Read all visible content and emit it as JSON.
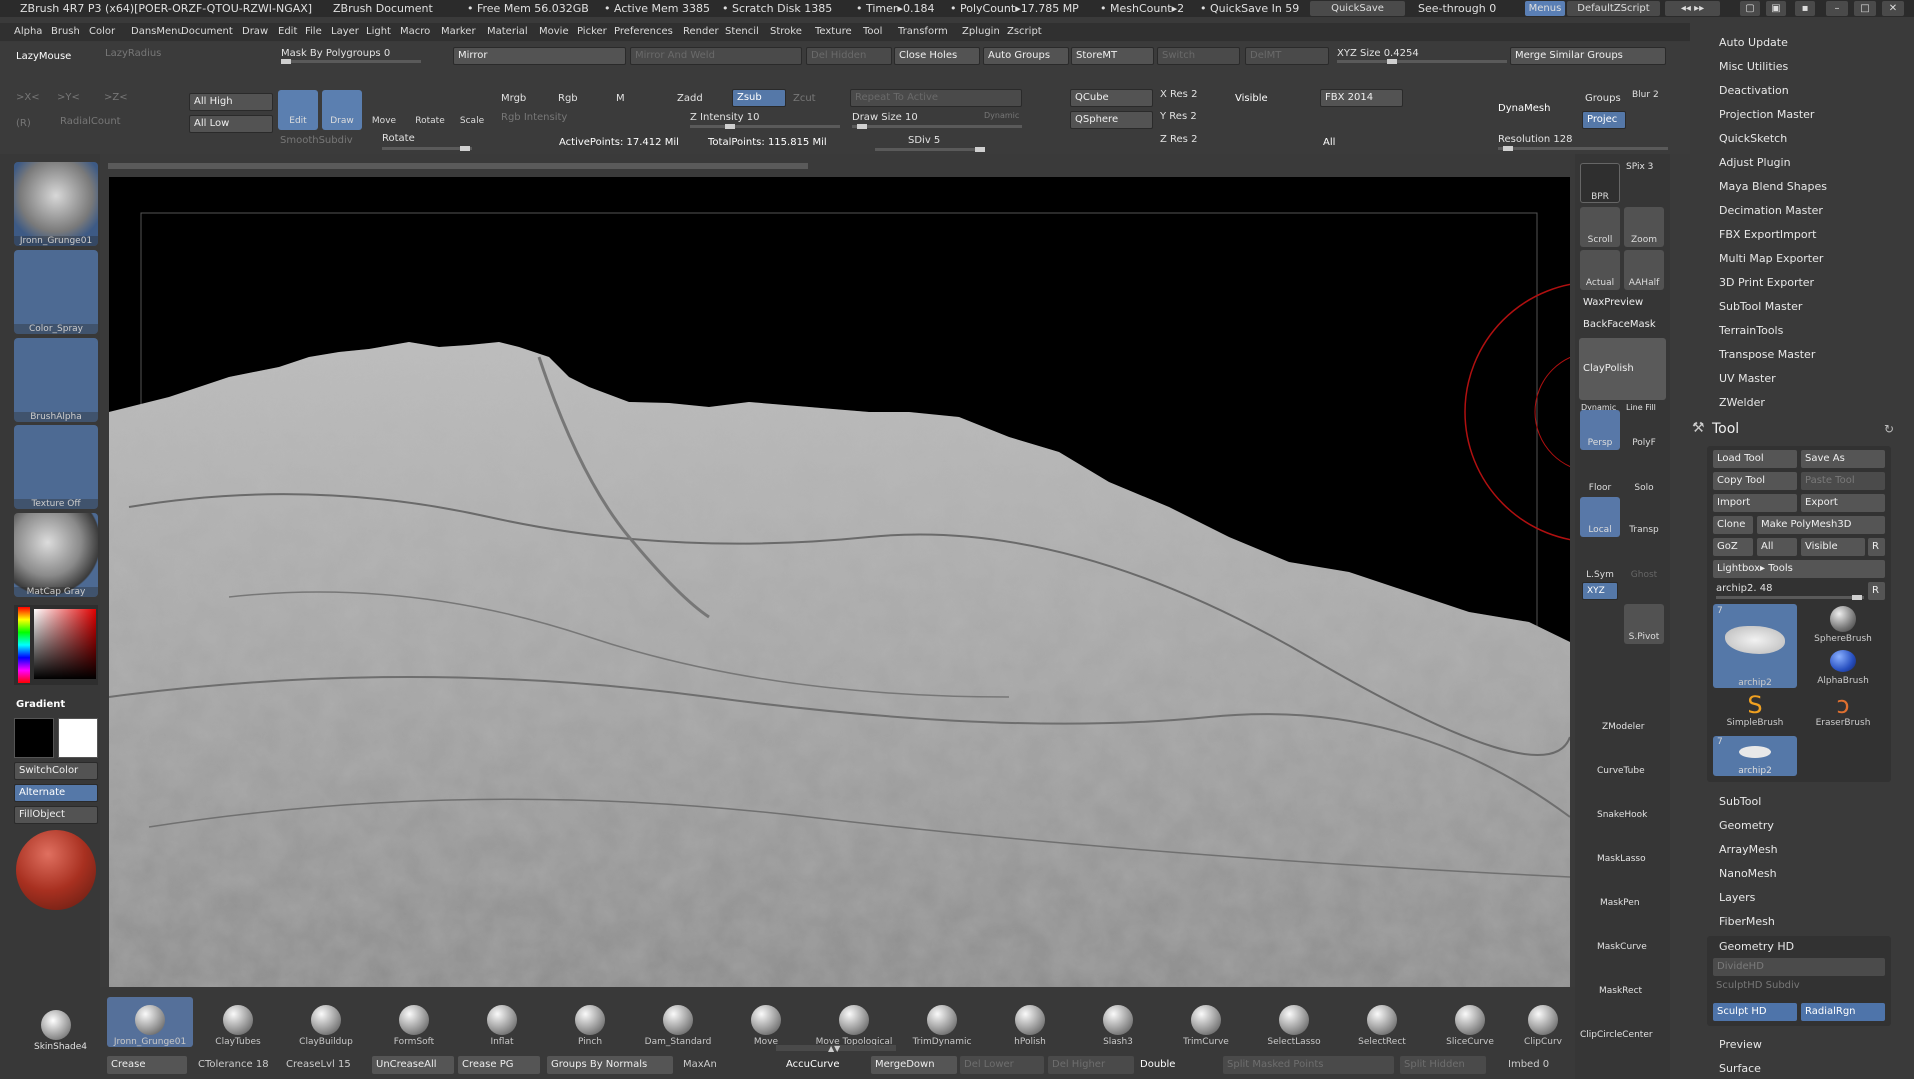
{
  "title": {
    "app": "ZBrush 4R7 P3 (x64)[POER-ORZF-QTOU-RZWI-NGAX]",
    "doc": "ZBrush Document",
    "freemem": "• Free Mem 56.032GB",
    "activemem": "• Active Mem 3385",
    "scratch": "• Scratch Disk 1385",
    "timer": "• Timer▸0.184",
    "poly": "• PolyCount▸17.785 MP",
    "meshcount": "• MeshCount▸2",
    "quicksave_in": "• QuickSave In 59",
    "quicksave": "QuickSave",
    "seethrough": "See-through 0",
    "menus": "Menus",
    "script": "DefaultZScript"
  },
  "menu": [
    "Alpha",
    "Brush",
    "Color",
    "DansMenu",
    "Document",
    "Draw",
    "Edit",
    "File",
    "Layer",
    "Light",
    "Macro",
    "Marker",
    "Material",
    "Movie",
    "Picker",
    "Preferences",
    "Render",
    "Stencil",
    "Stroke",
    "Texture",
    "Tool",
    "Transform",
    "Zplugin",
    "Zscript"
  ],
  "top": {
    "lazymouse": "LazyMouse",
    "lazyradius": "LazyRadius",
    "maskbypoly": "Mask By Polygroups 0",
    "mirror": "Mirror",
    "mirrorweld": "Mirror And Weld",
    "delhidden": "Del Hidden",
    "closeholes": "Close Holes",
    "autogroups": "Auto Groups",
    "storemt": "StoreMT",
    "switch": "Switch",
    "delmt": "DelMT",
    "xyzsize": "XYZ Size 0.4254",
    "mergesimilar": "Merge Similar Groups",
    "axisx": ">X<",
    "axisy": ">Y<",
    "axisz": ">Z<",
    "r": "(R)",
    "radialcount": "RadialCount",
    "allhigh": "All High",
    "alllow": "All Low",
    "smoothsubdiv": "SmoothSubdiv",
    "rotate": "Rotate",
    "edit": "Edit",
    "draw": "Draw",
    "move": "Move",
    "rotatet": "Rotate",
    "scale": "Scale",
    "mrgb": "Mrgb",
    "rgb": "Rgb",
    "m": "M",
    "zadd": "Zadd",
    "zsub": "Zsub",
    "zcut": "Zcut",
    "repeat": "Repeat To Active",
    "rgbint": "Rgb Intensity",
    "zint": "Z Intensity 10",
    "drawsize": "Draw Size 10",
    "dynamic": "Dynamic",
    "activepts": "ActivePoints: 17.412  Mil",
    "totalpts": "TotalPoints: 115.815  Mil",
    "sdiv": "SDiv 5",
    "qcube": "QCube",
    "qsphere": "QSphere",
    "xres": "X Res 2",
    "yres": "Y Res 2",
    "zres": "Z Res 2",
    "visible": "Visible",
    "all": "All",
    "fbx": "FBX 2014",
    "dynamesh": "DynaMesh",
    "groups": "Groups",
    "blur": "Blur 2",
    "projec": "Projec",
    "resolution": "Resolution 128"
  },
  "left": {
    "brush1": "Jronn_Grunge01",
    "brush2": "Color_Spray",
    "alpha": "BrushAlpha",
    "texture": "Texture Off",
    "matcap": "MatCap Gray",
    "gradient": "Gradient",
    "switchcolor": "SwitchColor",
    "alternate": "Alternate",
    "fillobject": "FillObject",
    "skinshade": "SkinShade4"
  },
  "strip": {
    "spix": "SPix 3",
    "bpr": "BPR",
    "scroll": "Scroll",
    "zoom": "Zoom",
    "actual": "Actual",
    "aahalf": "AAHalf",
    "waxpreview": "WaxPreview",
    "backfacemask": "BackFaceMask",
    "claypolish": "ClayPolish",
    "dynamic": "Dynamic",
    "persp": "Persp",
    "linefill": "Line Fill",
    "polyf": "PolyF",
    "floor": "Floor",
    "solo": "Solo",
    "local": "Local",
    "transp": "Transp",
    "lsym": "L.Sym",
    "ghost": "Ghost",
    "xyz": "XYZ",
    "spivot": "S.Pivot",
    "zmodeler": "ZModeler",
    "curvetube": "CurveTube",
    "snakehook": "SnakeHook",
    "masklasso": "MaskLasso",
    "maskpen": "MaskPen",
    "maskcurve": "MaskCurve",
    "maskrect": "MaskRect",
    "clipcircle": "ClipCircleCenter"
  },
  "tray": {
    "plugins": [
      "Auto Update",
      "Misc Utilities",
      "Deactivation",
      "Projection Master",
      "QuickSketch",
      "Adjust Plugin",
      "Maya Blend Shapes",
      "Decimation Master",
      "FBX ExportImport",
      "Multi Map Exporter",
      "3D Print Exporter",
      "SubTool Master",
      "TerrainTools",
      "Transpose Master",
      "UV Master",
      "ZWelder"
    ],
    "tool": "Tool",
    "loadtool": "Load Tool",
    "saveas": "Save As",
    "copytool": "Copy Tool",
    "pastetool": "Paste Tool",
    "import": "Import",
    "export": "Export",
    "clone": "Clone",
    "makepoly": "Make PolyMesh3D",
    "goz": "GoZ",
    "all": "All",
    "visible": "Visible",
    "r": "R",
    "lightbox": "Lightbox▸ Tools",
    "current": "archip2. 48",
    "tools": [
      "archip2",
      "SphereBrush",
      "AlphaBrush",
      "SimpleBrush",
      "EraserBrush",
      "archip2"
    ],
    "toolnum": "7",
    "sections": [
      "SubTool",
      "Geometry",
      "ArrayMesh",
      "NanoMesh",
      "Layers",
      "FiberMesh"
    ],
    "geometryhd": "Geometry HD",
    "dividehd": "DivideHD",
    "sculpthdsubdiv": "SculptHD Subdiv",
    "sculpthd": "Sculpt HD",
    "radialrgn": "RadialRgn",
    "preview": "Preview",
    "surface": "Surface"
  },
  "brushes": [
    "Jronn_Grunge01",
    "ClayTubes",
    "ClayBuildup",
    "FormSoft",
    "Inflat",
    "Pinch",
    "Dam_Standard",
    "Move",
    "Move Topological",
    "TrimDynamic",
    "hPolish",
    "Slash3",
    "TrimCurve",
    "SelectLasso",
    "SelectRect",
    "SliceCurve",
    "ClipCurv"
  ],
  "bottombar": {
    "crease": "Crease",
    "ctolerance": "CTolerance 18",
    "creaselvl": "CreaseLvl 15",
    "uncreaseall": "UnCreaseAll",
    "creasepg": "Crease PG",
    "groupsbynormals": "Groups By Normals",
    "maxan": "MaxAn",
    "accucurve": "AccuCurve",
    "mergedown": "MergeDown",
    "dellower": "Del Lower",
    "delhigher": "Del Higher",
    "double": "Double",
    "splitmasked": "Split Masked Points",
    "splithidden": "Split Hidden",
    "imbed": "Imbed 0"
  }
}
